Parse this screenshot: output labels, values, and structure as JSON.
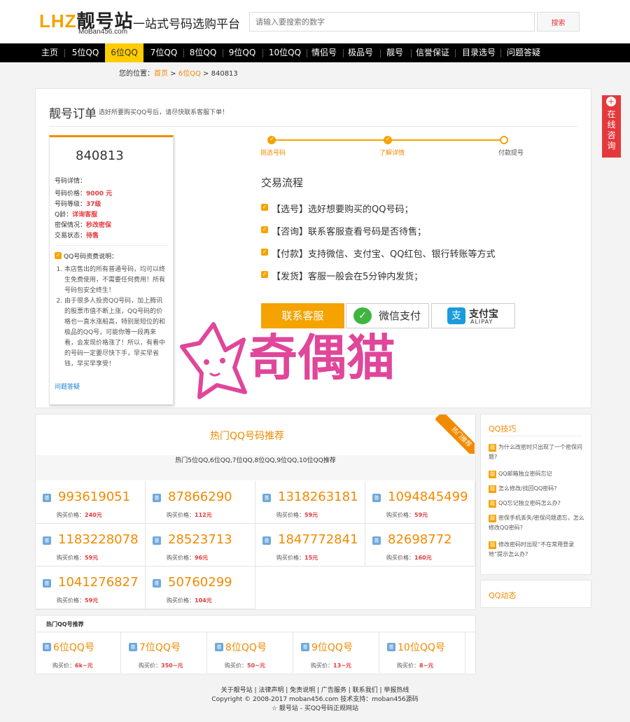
{
  "header": {
    "logo_text": "LHZ",
    "logo_cn": "靓号站",
    "logo_sub": "MoBan456.com",
    "slogan": "一站式号码选购平台",
    "search_placeholder": "请输入要搜索的数字",
    "search_button": "搜索"
  },
  "nav": [
    "主页",
    "5位QQ",
    "6位QQ",
    "7位QQ",
    "8位QQ",
    "9位QQ",
    "10位QQ",
    "情侣号",
    "极品号",
    "靓号",
    "信誉保证",
    "目录选号",
    "问题答疑"
  ],
  "breadcrumb": {
    "prefix": "您的位置：",
    "home": "首页",
    "sep1": " > ",
    "cat": "6位QQ",
    "sep2": " > ",
    "current": "840813"
  },
  "order": {
    "title": "靓号订单",
    "subtitle": "选好所要购买QQ号后，请尽快联系客服下单！",
    "number": "840813",
    "details_label": "号码详情：",
    "price_label": "号码价格：",
    "price": "9000 元",
    "level_label": "号码等级：",
    "level": "37级",
    "age_label": "Q龄：",
    "age": "详询客服",
    "protect_label": "密保情况：",
    "protect": "秒改密保",
    "status_label": "交易状态：",
    "status": "待售",
    "note_title": "QQ号码资费说明：",
    "notes": [
      "本店售出的所有普通号码，均可以终生免费使用，不需要任何费用！所有号码包安全终生！",
      "由于很多人投资QQ号码，加上腾讯的股票市值不断上涨，QQ号码的价格也一直水涨船高，特别是短位的和极品的QQ号，可能你等一段再来看，会发现价格涨了！所以，有看中的号码一定要尽快下手，早买早省钱，早买早享受！"
    ],
    "faq_link": "问题答疑"
  },
  "steps": [
    "挑选号码",
    "了解详情",
    "付款提号"
  ],
  "flow": {
    "title": "交易流程",
    "items": [
      "【选号】选好想要购买的QQ号码；",
      "【咨询】联系客服查看号码是否待售；",
      "【付款】支持微信、支付宝、QQ红包、银行转账等方式",
      "【发货】客服一般会在5分钟内发货；"
    ],
    "contact_button": "联系客服",
    "wechat_pay": "微信支付",
    "alipay_cn": "支付宝",
    "alipay_en": "ALIPAY"
  },
  "watermark": "奇偶猫",
  "hot": {
    "title": "热门QQ号码推荐",
    "subtitle": "热门5位QQ,6位QQ,7位QQ,8位QQ,9位QQ,10位QQ推荐",
    "ribbon": "热门推荐",
    "badge": "普",
    "price_label": "购买价格：",
    "numbers": [
      {
        "num": "993619051",
        "price": "240元"
      },
      {
        "num": "87866290",
        "price": "112元"
      },
      {
        "num": "1318263181",
        "price": "59元"
      },
      {
        "num": "1094845499",
        "price": "59元"
      },
      {
        "num": "1183228078",
        "price": "59元"
      },
      {
        "num": "28523713",
        "price": "96元"
      },
      {
        "num": "1847772841",
        "price": "15元"
      },
      {
        "num": "82698772",
        "price": "160元"
      },
      {
        "num": "1041276827",
        "price": "59元"
      },
      {
        "num": "50760299",
        "price": "104元"
      }
    ]
  },
  "categories": {
    "title": "热门QQ号推荐",
    "price_label": "购买价：",
    "items": [
      {
        "name": "6位QQ号",
        "price": "6k~元"
      },
      {
        "name": "7位QQ号",
        "price": "350~元"
      },
      {
        "name": "8位QQ号",
        "price": "50~元"
      },
      {
        "name": "9位QQ号",
        "price": "13~元"
      },
      {
        "name": "10位QQ号",
        "price": "8~元"
      }
    ]
  },
  "tips": {
    "title": "QQ技巧",
    "badge": "靓",
    "items": [
      "为什么改密时只出现了一个密保问题?",
      "QQ邮箱独立密码忘记",
      "怎么修改/找回QQ密码?",
      "QQ忘记独立密码怎么办?",
      "密保手机丢失/密保问题遗忘，怎么修改QQ密码?",
      "修改密码时出现“不在常用登录地”提示怎么办?"
    ],
    "dynamics_title": "QQ动态"
  },
  "online": "在线咨询",
  "footer": {
    "links": "关于靓号站 | 法律声明 | 免责说明 | 广告服务 | 联系我们 | 举报热线",
    "copyright": "Copyright © 2008-2017 moban456.com 技术支持：moban456源码",
    "tagline": "☆ 靓号站 - 买QQ号码正规网站"
  }
}
